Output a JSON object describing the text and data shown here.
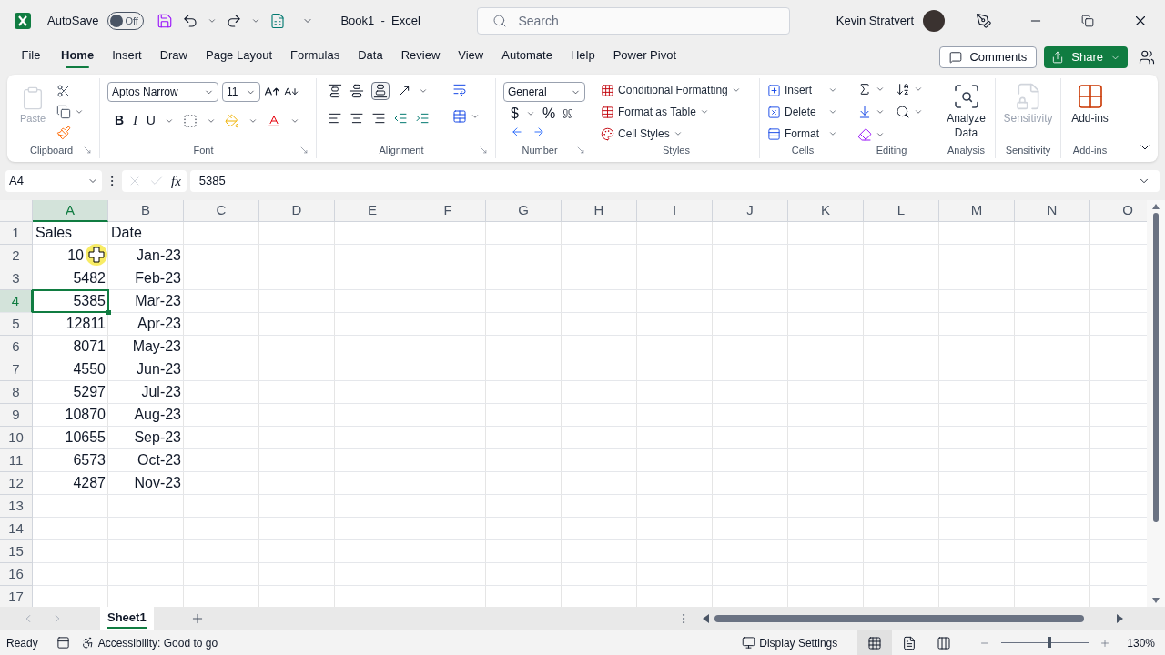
{
  "title_bar": {
    "autosave": {
      "label": "AutoSave",
      "state_text": "Off",
      "on": false
    },
    "title": "Book1  -  Excel",
    "search": {
      "placeholder": "Search"
    },
    "user": "Kevin Stratvert"
  },
  "menu_tabs": [
    {
      "label": "File",
      "selected": false
    },
    {
      "label": "Home",
      "selected": true
    },
    {
      "label": "Insert",
      "selected": false
    },
    {
      "label": "Draw",
      "selected": false
    },
    {
      "label": "Page Layout",
      "selected": false
    },
    {
      "label": "Formulas",
      "selected": false
    },
    {
      "label": "Data",
      "selected": false
    },
    {
      "label": "Review",
      "selected": false
    },
    {
      "label": "View",
      "selected": false
    },
    {
      "label": "Automate",
      "selected": false
    },
    {
      "label": "Help",
      "selected": false
    },
    {
      "label": "Power Pivot",
      "selected": false
    }
  ],
  "comments_button": "Comments",
  "share_button": "Share",
  "ribbon": [
    {
      "kind": "clipboard",
      "label": "Clipboard",
      "command": "Paste",
      "disabled": true
    },
    {
      "kind": "font",
      "label": "Font",
      "font_name": "Aptos Narrow",
      "font_size": "11",
      "styles": [
        "B",
        "I",
        "U"
      ]
    },
    {
      "kind": "alignment",
      "label": "Alignment"
    },
    {
      "kind": "number",
      "label": "Number",
      "format": "General",
      "symbols": [
        "$",
        "%"
      ]
    },
    {
      "kind": "styles",
      "label": "Styles",
      "commands": [
        "Conditional Formatting",
        "Format as Table",
        "Cell Styles"
      ]
    },
    {
      "kind": "cells",
      "label": "Cells",
      "commands": [
        "Insert",
        "Delete",
        "Format"
      ]
    },
    {
      "kind": "editing",
      "label": "Editing"
    },
    {
      "kind": "analysis",
      "label": "Analysis",
      "command": "Analyze Data",
      "disabled": false
    },
    {
      "kind": "sensitivity",
      "label": "Sensitivity",
      "command": "Sensitivity",
      "disabled": true
    },
    {
      "kind": "addins",
      "label": "Add-ins",
      "command": "Add-ins",
      "disabled": false
    }
  ],
  "formula_bar": {
    "name_box": "A4",
    "fx": "fx",
    "value": "5385"
  },
  "columns": [
    {
      "label": "A",
      "selected": true
    },
    {
      "label": "B",
      "selected": false
    },
    {
      "label": "C",
      "selected": false
    },
    {
      "label": "D",
      "selected": false
    },
    {
      "label": "E",
      "selected": false
    },
    {
      "label": "F",
      "selected": false
    },
    {
      "label": "G",
      "selected": false
    },
    {
      "label": "H",
      "selected": false
    },
    {
      "label": "I",
      "selected": false
    },
    {
      "label": "J",
      "selected": false
    },
    {
      "label": "K",
      "selected": false
    },
    {
      "label": "L",
      "selected": false
    },
    {
      "label": "M",
      "selected": false
    },
    {
      "label": "N",
      "selected": false
    },
    {
      "label": "O",
      "selected": false
    }
  ],
  "rows": [
    {
      "header": "1",
      "selected": false,
      "cells": [
        {
          "value": "Sales",
          "kind": "text"
        },
        {
          "value": "Date",
          "kind": "text"
        }
      ]
    },
    {
      "header": "2",
      "selected": false,
      "cells": [
        {
          "value": "10",
          "kind": "number",
          "pointer": true
        },
        {
          "value": "Jan-23",
          "kind": "number"
        }
      ]
    },
    {
      "header": "3",
      "selected": false,
      "cells": [
        {
          "value": "5482",
          "kind": "number"
        },
        {
          "value": "Feb-23",
          "kind": "number"
        }
      ]
    },
    {
      "header": "4",
      "selected": true,
      "cells": [
        {
          "value": "5385",
          "kind": "number"
        },
        {
          "value": "Mar-23",
          "kind": "number"
        }
      ]
    },
    {
      "header": "5",
      "selected": false,
      "cells": [
        {
          "value": "12811",
          "kind": "number"
        },
        {
          "value": "Apr-23",
          "kind": "number"
        }
      ]
    },
    {
      "header": "6",
      "selected": false,
      "cells": [
        {
          "value": "8071",
          "kind": "number"
        },
        {
          "value": "May-23",
          "kind": "number"
        }
      ]
    },
    {
      "header": "7",
      "selected": false,
      "cells": [
        {
          "value": "4550",
          "kind": "number"
        },
        {
          "value": "Jun-23",
          "kind": "number"
        }
      ]
    },
    {
      "header": "8",
      "selected": false,
      "cells": [
        {
          "value": "5297",
          "kind": "number"
        },
        {
          "value": "Jul-23",
          "kind": "number"
        }
      ]
    },
    {
      "header": "9",
      "selected": false,
      "cells": [
        {
          "value": "10870",
          "kind": "number"
        },
        {
          "value": "Aug-23",
          "kind": "number"
        }
      ]
    },
    {
      "header": "10",
      "selected": false,
      "cells": [
        {
          "value": "10655",
          "kind": "number"
        },
        {
          "value": "Sep-23",
          "kind": "number"
        }
      ]
    },
    {
      "header": "11",
      "selected": false,
      "cells": [
        {
          "value": "6573",
          "kind": "number"
        },
        {
          "value": "Oct-23",
          "kind": "number"
        }
      ]
    },
    {
      "header": "12",
      "selected": false,
      "cells": [
        {
          "value": "4287",
          "kind": "number"
        },
        {
          "value": "Nov-23",
          "kind": "number"
        }
      ]
    },
    {
      "header": "13",
      "selected": false
    },
    {
      "header": "14",
      "selected": false
    },
    {
      "header": "15",
      "selected": false
    },
    {
      "header": "16",
      "selected": false
    },
    {
      "header": "17",
      "selected": false
    }
  ],
  "sheet_tabs": [
    {
      "label": "Sheet1",
      "selected": true
    }
  ],
  "status_bar": {
    "status": "Ready",
    "accessibility": "Accessibility: Good to go",
    "display_settings": "Display Settings",
    "views": [
      {
        "kind": "normal",
        "selected": true
      },
      {
        "kind": "page_layout",
        "selected": false
      },
      {
        "kind": "page_break",
        "selected": false
      }
    ],
    "zoom": {
      "level": 0.55,
      "reading": "130%"
    }
  }
}
